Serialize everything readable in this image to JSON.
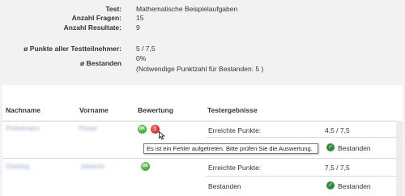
{
  "summary": {
    "test_label": "Test:",
    "test_value": "Mathematische Beispielaufgaben",
    "questions_label": "Anzahl Fragen:",
    "questions_value": "15",
    "results_label": "Anzahl Resultate:",
    "results_value": "9",
    "avg_points_label": "ø Punkte aller Testteilnehmer:",
    "avg_points_value": "5 / 7,5",
    "passed_label": "ø Bestanden",
    "passed_value": "0%",
    "passed_note": "(Notwendige Punktzahl für Bestanden:  5 )"
  },
  "table": {
    "headers": {
      "lastname": "Nachname",
      "firstname": "Vorname",
      "rating": "Bewertung",
      "results": "Testergebnisse"
    },
    "rows": [
      {
        "lastname": "Pinkelmann",
        "firstname": "Pinaar",
        "rating_ok": "OK",
        "rating_error": "!",
        "tooltip": "Es ist ein Fehler aufgetreten. Bitte prüfen Sie die Auswertung.",
        "points_label": "Erreichte Punkte:",
        "points_value": "4,5 / 7,5",
        "status_label": "Bestanden"
      },
      {
        "lastname": "Ostwing",
        "firstname": "Jakanoh",
        "rating_ok": "OK",
        "points_label": "Erreichte Punkte:",
        "points_value": "7,5 / 7,5",
        "status_prefix": "Bestanden",
        "status_label": "Bestanden"
      }
    ]
  },
  "icons": {
    "ok": "ok-icon",
    "error": "error-icon",
    "check": "check-circle-icon",
    "cursor": "pointer-cursor-icon"
  },
  "colors": {
    "ok_green": "#2f9a1f",
    "error_red": "#b81818",
    "check_green": "#2e8b3d",
    "blurred_name": "#8fa8c8"
  }
}
